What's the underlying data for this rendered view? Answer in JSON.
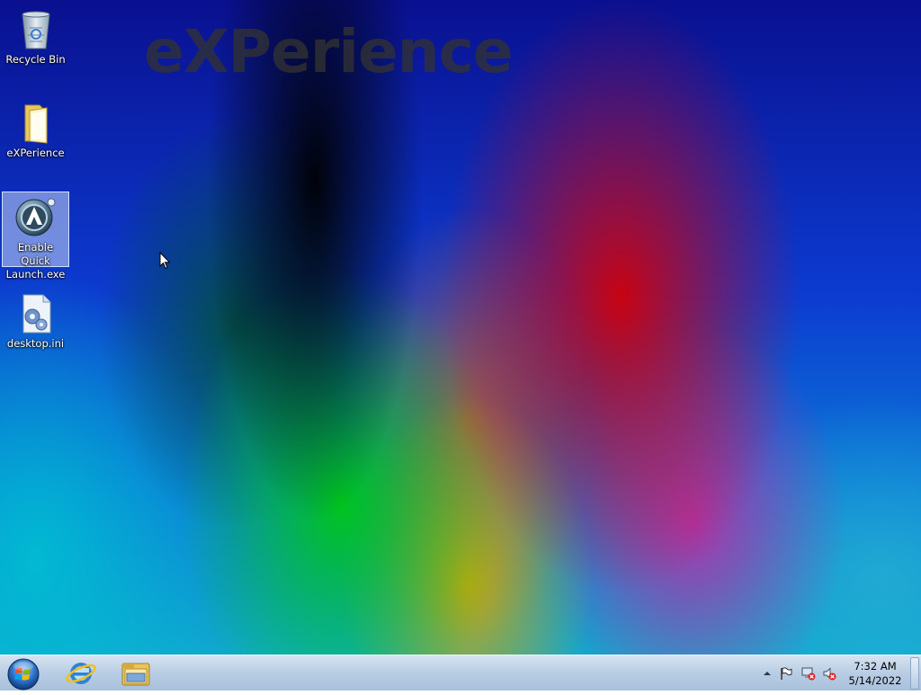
{
  "desktop": {
    "watermark": "eXPerience",
    "icons": [
      {
        "label": "Recycle Bin",
        "icon": "recycle-bin-icon"
      },
      {
        "label": "eXPerience",
        "icon": "folder-icon"
      },
      {
        "label": "Enable Quick Launch.exe",
        "icon": "app-exe-icon",
        "selected": true
      },
      {
        "label": "desktop.ini",
        "icon": "settings-file-icon"
      }
    ]
  },
  "taskbar": {
    "start": {
      "icon": "windows-start-orb-icon"
    },
    "pinned": [
      {
        "icon": "internet-explorer-icon"
      },
      {
        "icon": "file-explorer-icon"
      }
    ],
    "tray": {
      "icons": [
        "show-hidden-icons-arrow",
        "action-center-flag-icon",
        "network-error-icon",
        "volume-muted-icon"
      ],
      "clock": {
        "time": "7:32 AM",
        "date": "5/14/2022"
      }
    }
  },
  "colors": {
    "taskbar": "#b9cde4",
    "selection": "#c8d7f5"
  }
}
